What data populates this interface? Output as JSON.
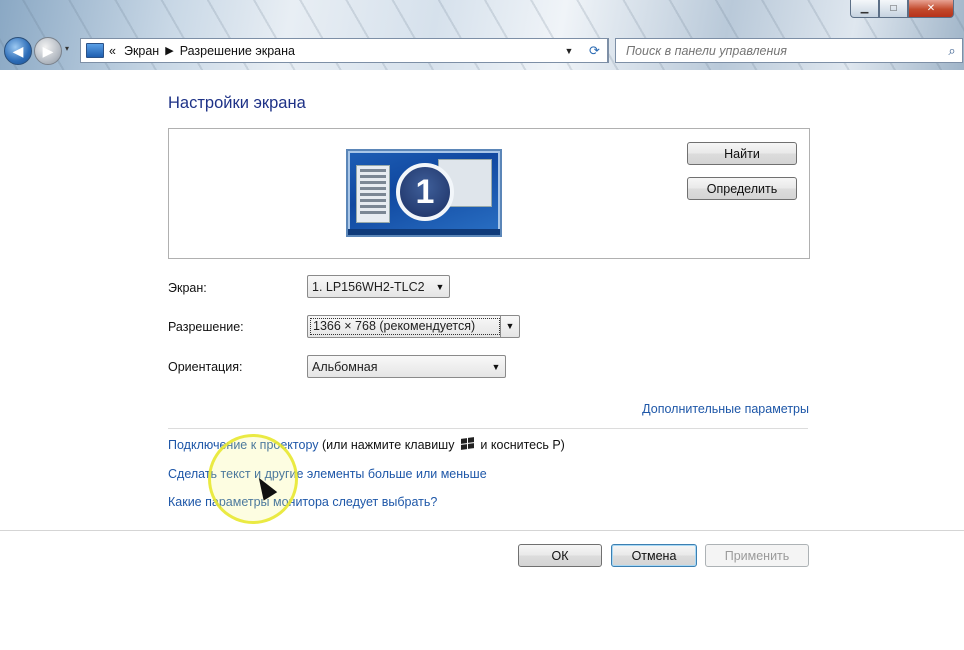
{
  "window": {
    "controls": {
      "minimize": "▁",
      "maximize": "□",
      "close": "✕"
    }
  },
  "nav": {
    "back_icon": "◀",
    "forward_icon": "▶",
    "history_icon": "▾",
    "breadcrumb_prefix": "«",
    "breadcrumb": [
      "Экран",
      "Разрешение экрана"
    ],
    "breadcrumb_sep": "▶",
    "address_dropdown_icon": "▼",
    "refresh_icon": "⟳",
    "search_placeholder": "Поиск в панели управления",
    "search_icon": "⌕"
  },
  "main": {
    "title": "Настройки экрана",
    "monitor_number": "1",
    "find_button": "Найти",
    "identify_button": "Определить",
    "fields": {
      "display_label": "Экран:",
      "display_value": "1. LP156WH2-TLC2",
      "resolution_label": "Разрешение:",
      "resolution_value": "1366 × 768 (рекомендуется)",
      "orientation_label": "Ориентация:",
      "orientation_value": "Альбомная"
    },
    "dropdown_arrow": "▼",
    "advanced_link": "Дополнительные параметры",
    "projector_link": "Подключение к проектору",
    "projector_hint_before": "(или нажмите клавишу",
    "projector_hint_after": "и коснитесь P)",
    "text_size_link": "Сделать текст и другие элементы больше или меньше",
    "monitor_help_link": "Какие параметры монитора следует выбрать?"
  },
  "footer": {
    "ok_button": "ОК",
    "cancel_button": "Отмена",
    "apply_button": "Применить"
  },
  "colors": {
    "heading": "#1e3287",
    "link": "#1e57a8",
    "cursor_highlight": "#e8e832"
  }
}
